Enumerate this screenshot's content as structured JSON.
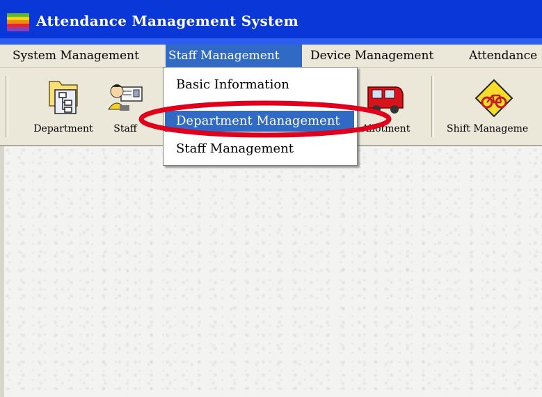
{
  "window": {
    "title": "Attendance Management System",
    "icon": "app-logo-icon"
  },
  "menubar": {
    "items": [
      {
        "label": "System Management"
      },
      {
        "label": "Staff Management",
        "active": true
      },
      {
        "label": "Device Management"
      },
      {
        "label": "Attendance"
      }
    ]
  },
  "toolbar": {
    "buttons": [
      {
        "label": "Department",
        "icon": "department-tree-icon"
      },
      {
        "label": "Staff",
        "icon": "staff-card-icon"
      },
      {
        "label": "Allotment",
        "icon": "red-car-icon"
      },
      {
        "label": "Shift Manageme",
        "icon": "bicycle-sign-icon"
      }
    ]
  },
  "dropdown": {
    "items": [
      {
        "label": "Basic Information"
      },
      {
        "label": "Department Management",
        "selected": true
      },
      {
        "label": "Staff Management"
      }
    ]
  },
  "colors": {
    "titlebar": "#0a38d8",
    "selection": "#316ac5",
    "highlight_ellipse": "#e0001b",
    "chrome": "#ebe8d9"
  }
}
